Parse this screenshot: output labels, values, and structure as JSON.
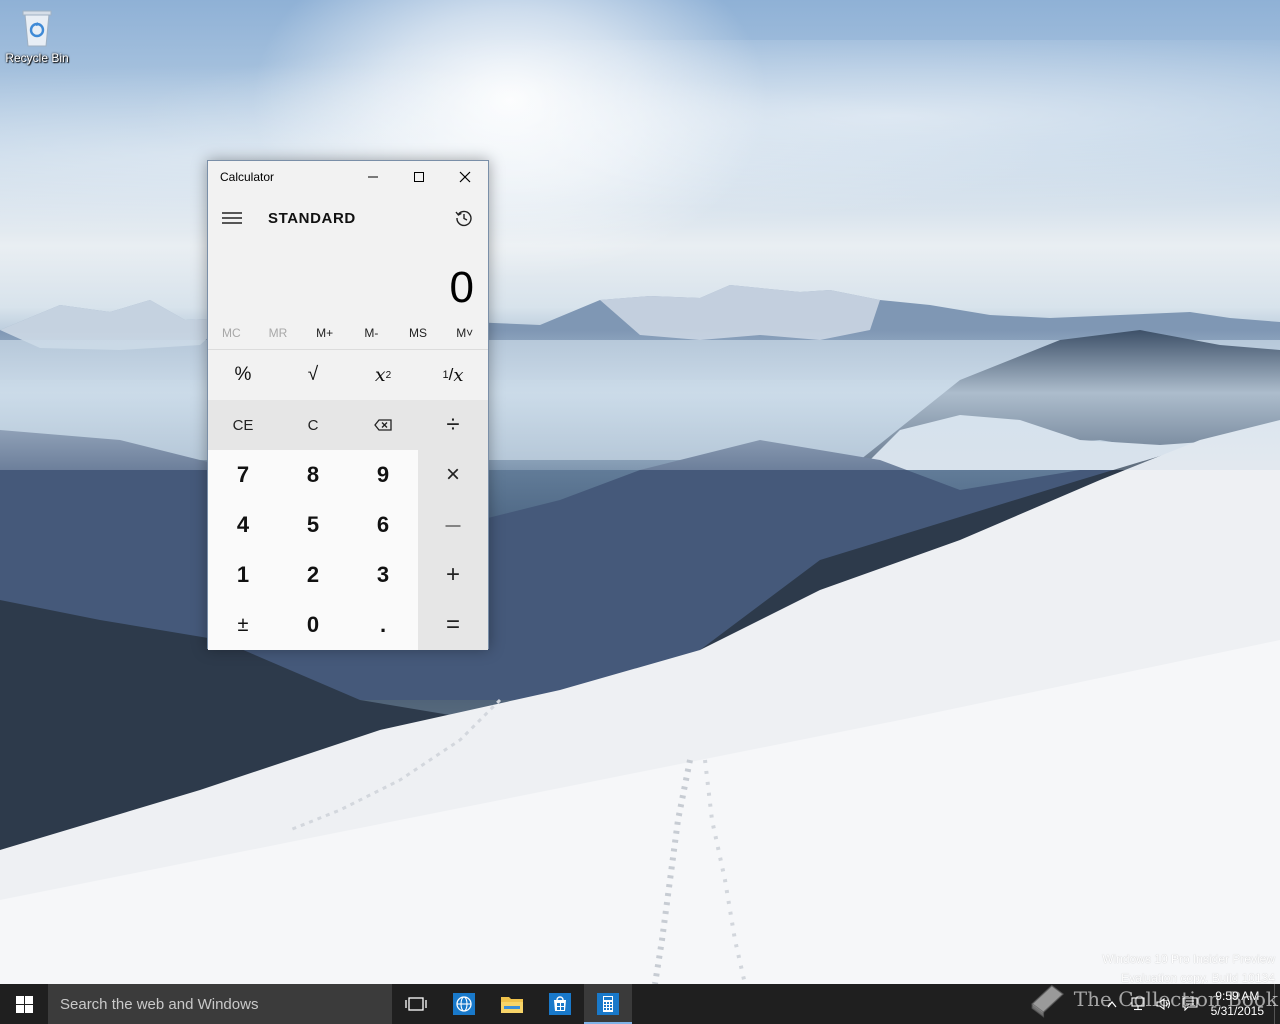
{
  "desktop": {
    "icons": [
      {
        "label": "Recycle Bin"
      }
    ],
    "watermark": {
      "line1": "Windows 10 Pro Insider Preview",
      "line2": "Evaluation copy. Build 10134"
    },
    "overlay_logo_text": "The Collection Book"
  },
  "calculator": {
    "title": "Calculator",
    "mode": "STANDARD",
    "display_value": "0",
    "memory": [
      {
        "label": "MC",
        "enabled": false
      },
      {
        "label": "MR",
        "enabled": false
      },
      {
        "label": "M+",
        "enabled": true
      },
      {
        "label": "M-",
        "enabled": true
      },
      {
        "label": "MS",
        "enabled": true
      },
      {
        "label": "M˅",
        "enabled": false
      }
    ],
    "keys": {
      "percent": "%",
      "sqrt": "√",
      "square": "x²",
      "reciprocal": "¹⁄x",
      "ce": "CE",
      "c": "C",
      "divide": "÷",
      "seven": "7",
      "eight": "8",
      "nine": "9",
      "multiply": "×",
      "four": "4",
      "five": "5",
      "six": "6",
      "minus": "—",
      "one": "1",
      "two": "2",
      "three": "3",
      "plus": "+",
      "negate": "±",
      "zero": "0",
      "decimal": ".",
      "equals": "="
    }
  },
  "taskbar": {
    "search_placeholder": "Search the web and Windows",
    "clock_time": "9:59 AM",
    "clock_date": "5/31/2015",
    "pinned": [
      "task-view-icon",
      "edge-icon",
      "file-explorer-icon",
      "store-icon",
      "calculator-icon"
    ],
    "accent_color": "#7fb2e6"
  }
}
